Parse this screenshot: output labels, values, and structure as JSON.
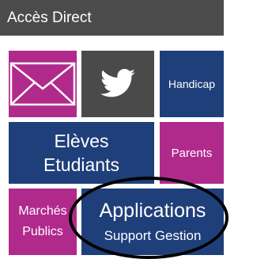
{
  "header": {
    "title": "Accès Direct"
  },
  "tiles": {
    "mail": {
      "icon": "envelope-icon"
    },
    "twitter": {
      "icon": "twitter-bird-icon"
    },
    "handicap": {
      "label": "Handicap"
    },
    "eleves": {
      "line1": "Elèves",
      "line2": "Etudiants"
    },
    "parents": {
      "label": "Parents"
    },
    "marches": {
      "line1": "Marchés",
      "line2": "Publics"
    },
    "applications": {
      "title": "Applications",
      "subtitle": "Support Gestion"
    }
  },
  "colors": {
    "header_bg": "#4b4b4b",
    "pink": "#b02a8c",
    "navy": "#1f3f7a",
    "gray": "#4a4a4a",
    "annotation": "#000000"
  }
}
